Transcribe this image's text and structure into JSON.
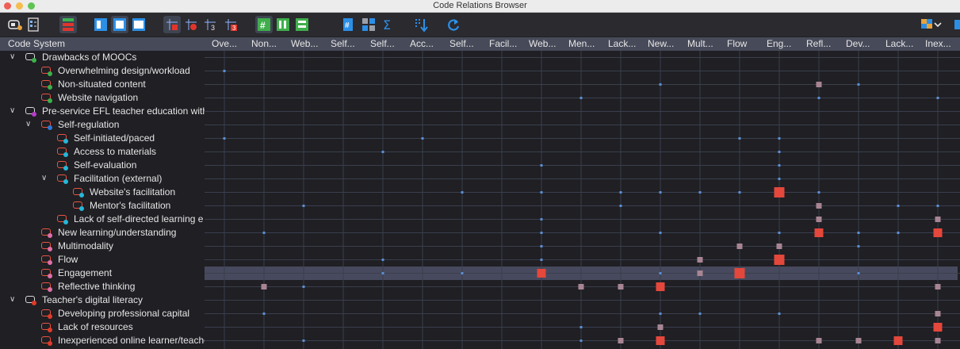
{
  "window": {
    "title": "Code Relations Browser"
  },
  "colors": {
    "hit_low": "#5b8fd6",
    "hit_mid": "#a88593",
    "hit_high": "#e4473b",
    "grid": "#3a3f4c"
  },
  "toolbar": {
    "icons": [
      "code-system-icon",
      "document-browser-icon",
      "color-legend-icon",
      "single-window-icon",
      "split-window-icon",
      "full-window-icon",
      "squares-toggle-icon",
      "dots-toggle-icon",
      "numbers-toggle-icon",
      "numbers-red-icon",
      "grid-icon",
      "columns-icon",
      "rows-icon",
      "hash-icon",
      "matrix-icon",
      "sigma-icon",
      "sort-icon",
      "refresh-icon",
      "export-icon"
    ]
  },
  "header": {
    "code_system": "Code System"
  },
  "columns": [
    "Ove...",
    "Non...",
    "Web...",
    "Self...",
    "Self...",
    "Acc...",
    "Self...",
    "Facil...",
    "Web...",
    "Men...",
    "Lack...",
    "New...",
    "Mult...",
    "Flow",
    "Eng...",
    "Refl...",
    "Dev...",
    "Lack...",
    "Inex..."
  ],
  "rows": [
    {
      "label": "Drawbacks of MOOCs",
      "level": 0,
      "expanded": true,
      "dot": "#3cb04a",
      "icon": "gray"
    },
    {
      "label": "Overwhelming design/workload",
      "level": 1,
      "dot": "#3cb04a"
    },
    {
      "label": "Non-situated content",
      "level": 1,
      "dot": "#3cb04a"
    },
    {
      "label": "Website navigation",
      "level": 1,
      "dot": "#3cb04a"
    },
    {
      "label": "Pre-service EFL teacher education with",
      "level": 0,
      "expanded": true,
      "dot": "#b83cc8",
      "icon": "gray"
    },
    {
      "label": "Self-regulation",
      "level": 1,
      "expanded": true,
      "dot": "#2f79d8"
    },
    {
      "label": "Self-initiated/paced",
      "level": 2,
      "dot": "#26b7d8"
    },
    {
      "label": "Access to materials",
      "level": 2,
      "dot": "#26b7d8"
    },
    {
      "label": "Self-evaluation",
      "level": 2,
      "dot": "#26b7d8"
    },
    {
      "label": "Facilitation (external)",
      "level": 2,
      "expanded": true,
      "dot": "#26b7d8"
    },
    {
      "label": "Website's facilitation",
      "level": 3,
      "dot": "#26b7d8"
    },
    {
      "label": "Mentor's facilitation",
      "level": 3,
      "dot": "#26b7d8"
    },
    {
      "label": "Lack of self-directed learning e",
      "level": 2,
      "dot": "#26b7d8"
    },
    {
      "label": "New learning/understanding",
      "level": 1,
      "dot": "#e06fa8"
    },
    {
      "label": "Multimodality",
      "level": 1,
      "dot": "#e06fa8"
    },
    {
      "label": "Flow",
      "level": 1,
      "dot": "#e06fa8"
    },
    {
      "label": "Engagement",
      "level": 1,
      "dot": "#e06fa8"
    },
    {
      "label": "Reflective thinking",
      "level": 1,
      "dot": "#e06fa8"
    },
    {
      "label": "Teacher's digital literacy",
      "level": 0,
      "expanded": true,
      "dot": "#e03a2a",
      "icon": "gray"
    },
    {
      "label": "Developing professional capital",
      "level": 1,
      "dot": "#e03a2a"
    },
    {
      "label": "Lack of resources",
      "level": 1,
      "dot": "#e03a2a"
    },
    {
      "label": "Inexperienced online learner/teache",
      "level": 1,
      "dot": "#e03a2a"
    }
  ],
  "selected_row": 16,
  "cells": [
    [
      1,
      0,
      1
    ],
    [
      2,
      11,
      1
    ],
    [
      2,
      15,
      2
    ],
    [
      2,
      16,
      1
    ],
    [
      3,
      9,
      1
    ],
    [
      3,
      15,
      1
    ],
    [
      3,
      18,
      1
    ],
    [
      6,
      0,
      1
    ],
    [
      6,
      5,
      1
    ],
    [
      6,
      13,
      1
    ],
    [
      6,
      14,
      1
    ],
    [
      7,
      4,
      1
    ],
    [
      7,
      14,
      1
    ],
    [
      8,
      8,
      1
    ],
    [
      8,
      14,
      1
    ],
    [
      9,
      14,
      1
    ],
    [
      10,
      6,
      1
    ],
    [
      10,
      8,
      1
    ],
    [
      10,
      10,
      1
    ],
    [
      10,
      11,
      1
    ],
    [
      10,
      12,
      1
    ],
    [
      10,
      13,
      1
    ],
    [
      10,
      14,
      4
    ],
    [
      10,
      15,
      1
    ],
    [
      11,
      2,
      1
    ],
    [
      11,
      10,
      1
    ],
    [
      11,
      15,
      2
    ],
    [
      11,
      17,
      1
    ],
    [
      11,
      18,
      1
    ],
    [
      12,
      8,
      1
    ],
    [
      12,
      15,
      2
    ],
    [
      12,
      18,
      2
    ],
    [
      13,
      1,
      1
    ],
    [
      13,
      8,
      1
    ],
    [
      13,
      11,
      1
    ],
    [
      13,
      14,
      1
    ],
    [
      13,
      15,
      3
    ],
    [
      13,
      16,
      1
    ],
    [
      13,
      17,
      1
    ],
    [
      13,
      18,
      3
    ],
    [
      14,
      8,
      1
    ],
    [
      14,
      13,
      2
    ],
    [
      14,
      14,
      2
    ],
    [
      14,
      16,
      1
    ],
    [
      15,
      4,
      1
    ],
    [
      15,
      8,
      1
    ],
    [
      15,
      12,
      2
    ],
    [
      15,
      14,
      4
    ],
    [
      16,
      4,
      1
    ],
    [
      16,
      6,
      1
    ],
    [
      16,
      8,
      3
    ],
    [
      16,
      11,
      1
    ],
    [
      16,
      12,
      2
    ],
    [
      16,
      13,
      4
    ],
    [
      16,
      16,
      1
    ],
    [
      17,
      1,
      2
    ],
    [
      17,
      2,
      1
    ],
    [
      17,
      9,
      2
    ],
    [
      17,
      10,
      2
    ],
    [
      17,
      11,
      3
    ],
    [
      17,
      18,
      2
    ],
    [
      19,
      1,
      1
    ],
    [
      19,
      11,
      1
    ],
    [
      19,
      12,
      1
    ],
    [
      19,
      14,
      1
    ],
    [
      19,
      18,
      2
    ],
    [
      20,
      9,
      1
    ],
    [
      20,
      11,
      2
    ],
    [
      20,
      18,
      3
    ],
    [
      21,
      2,
      1
    ],
    [
      21,
      9,
      1
    ],
    [
      21,
      10,
      2
    ],
    [
      21,
      11,
      3
    ],
    [
      21,
      15,
      2
    ],
    [
      21,
      16,
      2
    ],
    [
      21,
      17,
      3
    ],
    [
      21,
      18,
      2
    ]
  ]
}
